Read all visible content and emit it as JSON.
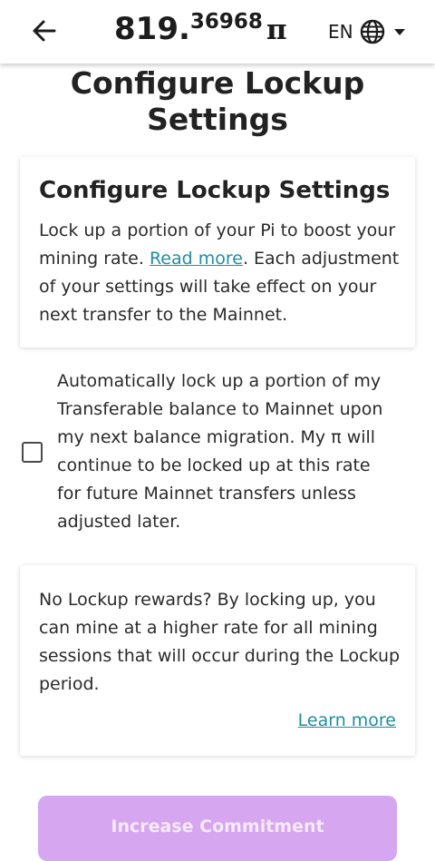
{
  "header": {
    "balance_int": "819.",
    "balance_frac": "36968",
    "currency_symbol": "π",
    "language": "EN"
  },
  "page_title": "Configure Lockup Settings",
  "info_card": {
    "title": "Configure Lockup Settings",
    "text_before": "Lock up a portion of your Pi to boost your mining rate. ",
    "link": "Read more",
    "text_after": ". Each adjustment of your settings will take effect on your next transfer to the Mainnet."
  },
  "auto_lockup": {
    "checked": false,
    "text": "Automatically lock up a portion of my Transferable balance to Mainnet upon my next balance migration. My π will continue to be locked up at this rate for future Mainnet transfers unless adjusted later."
  },
  "rewards_card": {
    "text": "No Lockup rewards? By locking up, you can mine at a higher rate for all mining sessions that will occur during the Lockup period.",
    "link": "Learn more"
  },
  "cta": {
    "label": "Increase Commitment"
  },
  "colors": {
    "link": "#1e8ea0",
    "cta_bg": "#d7a6f0"
  },
  "icons": [
    "arrow-left-icon",
    "globe-icon",
    "caret-down-icon"
  ]
}
